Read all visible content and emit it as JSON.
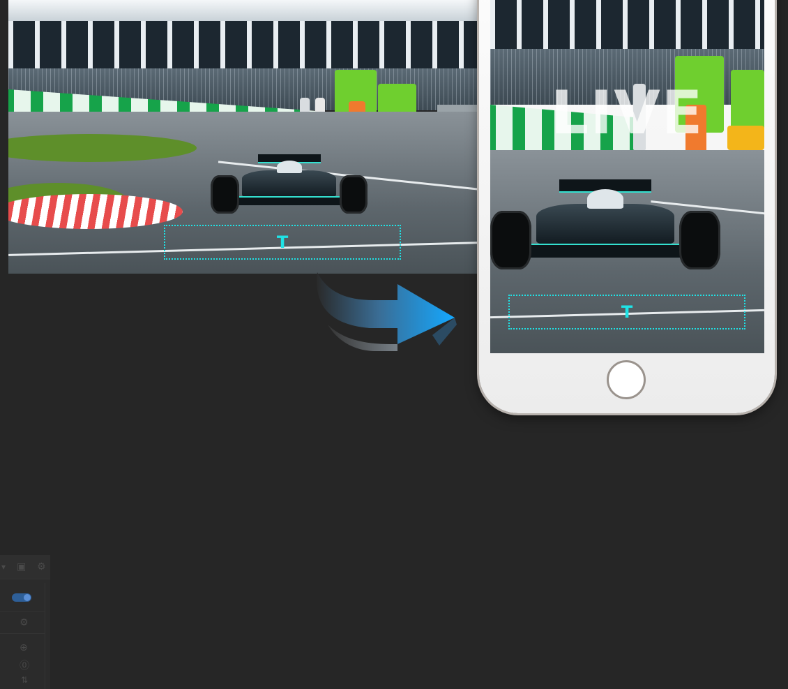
{
  "preview": {
    "live_label": "LIVE",
    "text_placeholder_glyph": "T",
    "accent_color": "#1fe3e6"
  },
  "panel": {
    "toggle_state": "on",
    "icons": [
      "dropdown-caret-icon",
      "square-icon",
      "gear-icon",
      "settings-icon",
      "plus-circle-icon",
      "info-circle-icon",
      "sort-icon"
    ]
  }
}
